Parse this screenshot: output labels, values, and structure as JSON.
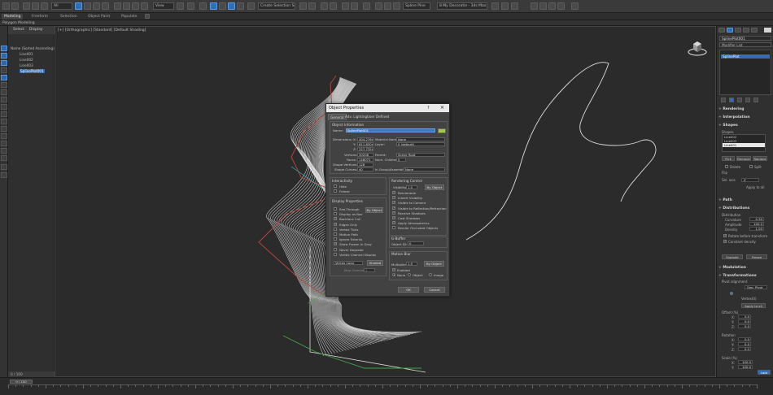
{
  "toolbar": {
    "selection_filter": "All",
    "ref_coord": "View",
    "named_selection": "Create Selection Se...",
    "object_name": "Spline Pine",
    "workspace": "8 My Decoratie - 3ds Max 2017"
  },
  "ribbon": {
    "tabs": [
      "Modeling",
      "Freeform",
      "Selection",
      "Object Paint",
      "Populate"
    ],
    "sub": "Polygon Modeling"
  },
  "explorer": {
    "tabs": [
      "Select",
      "Display"
    ],
    "items": [
      "Name (Sorted Ascending)",
      "Line001",
      "Line002",
      "Line003",
      "SplinePlot001"
    ],
    "footer": "0 / 100"
  },
  "viewport": {
    "label": "[+] [Orthographic] [Standard] [Default Shading]"
  },
  "dialog": {
    "title": "Object Properties",
    "help": "?",
    "close": "✕",
    "tabs": [
      "General",
      "Adv. Lighting",
      "User Defined"
    ],
    "object_info": {
      "title": "Object Information",
      "name_label": "Name:",
      "name_value": "SplinePlot001",
      "dimensions_label": "Dimensions:",
      "dim_x_label": "X:",
      "dim_x": "404.276m",
      "dim_y_label": "Y:",
      "dim_y": "611.830m",
      "dim_z_label": "Z:",
      "dim_z": "227.735m",
      "material_name_label": "Material Name:",
      "material_name": "None",
      "layer_label": "Layer:",
      "layer": "0 (default)",
      "vertices_label": "Vertices:",
      "vertices": "30208",
      "faces_label": "Faces:",
      "faces": "148072",
      "shape_vertices_label": "Shape Vertices:",
      "shape_vertices": "128",
      "shape_curves_label": "Shape Curves:",
      "shape_curves": "40",
      "parent_label": "Parent:",
      "parent": "Scene Root",
      "num_children_label": "Num. Children:",
      "num_children": "0",
      "in_group_label": "In Group/Assembly:",
      "in_group": "None"
    },
    "interactivity": {
      "title": "Interactivity",
      "hide": "Hide",
      "freeze": "Freeze"
    },
    "display_props": {
      "title": "Display Properties",
      "items": [
        "See-Through",
        "Display as Box",
        "Backface Cull",
        "Edges Only",
        "Vertex Ticks",
        "Motion Path",
        "Ignore Extents",
        "Show Frozen in Gray",
        "Never Degrade",
        "Vertex Channel Display"
      ],
      "checked": [
        false,
        false,
        true,
        true,
        false,
        false,
        false,
        true,
        false,
        false
      ],
      "by_object": "By Object",
      "vertex_color": "Vertex Color",
      "shaded": "Shaded",
      "map_channel_label": "Map Channel:",
      "map_channel": "1"
    },
    "rendering": {
      "title": "Rendering Control",
      "visibility_label": "Visibility:",
      "visibility": "1.0",
      "by_object": "By Object",
      "items": [
        "Renderable",
        "Inherit Visibility",
        "Visible to Camera",
        "Visible to Reflection/Refraction",
        "Receive Shadows",
        "Cast Shadows",
        "Apply Atmospherics",
        "Render Occluded Objects"
      ],
      "checked": [
        true,
        true,
        true,
        true,
        true,
        true,
        true,
        false
      ]
    },
    "gbuffer": {
      "title": "G-Buffer",
      "object_id_label": "Object ID:",
      "object_id": "0"
    },
    "motion_blur": {
      "title": "Motion Blur",
      "multiplier_label": "Multiplier:",
      "multiplier": "1.0",
      "by_object": "By Object",
      "enabled": "Enabled",
      "none": "None",
      "object": "Object",
      "image": "Image"
    },
    "ok": "OK",
    "cancel": "Cancel"
  },
  "command_panel": {
    "object_name": "SplinePlot001",
    "modifier_list": "Modifier List",
    "stack_item": "SplinePlot",
    "rollouts": [
      "Rendering",
      "Interpolation",
      "Shapes",
      "Path",
      "Distributions",
      "Modulation",
      "Transformations"
    ],
    "shapes_label": "Shapes",
    "shape_items": [
      "Line002",
      "Line003",
      "Line001"
    ],
    "pick": "Pick",
    "remove": "Remove",
    "replace": "Replace",
    "delete": "Delete",
    "flip": "Flip",
    "split": "Split",
    "sel_axis_label": "Sel. axis",
    "sel_axis": "Z",
    "apply_to_all": "Apply to all",
    "distribution_label": "Distribution",
    "curvature_label": "Curvature",
    "curvature": "0.30",
    "amplitude_label": "Amplitude",
    "amplitude": "100.0",
    "density_label": "Density",
    "density": "1.00",
    "rotate_before": "Rotate before transform",
    "constant_density": "Constant density",
    "explode": "Explode",
    "freeze": "Freeze",
    "pivot_alignment": "Pivot alignment",
    "align_label": "Geo. Pivot",
    "vertex_label": "Vertex(0)",
    "apply_all_btn": "Apply to all",
    "offset_label": "Offset (%)",
    "rotation_label": "Rotation",
    "scale_label": "Scale (%)",
    "x_label": "X:",
    "y_label": "Y:",
    "z_label": "Z:",
    "offset_x": "0.0",
    "offset_y": "0.0",
    "offset_z": "0.0",
    "rot_x": "0.0",
    "rot_y": "0.0",
    "rot_z": "0.0",
    "scale_x": "100.0",
    "scale_y": "100.0",
    "lock": "Lock"
  },
  "timeline": {
    "slider": "0 / 100"
  },
  "colors": {
    "accent": "#2f6fb8",
    "object_swatch": "#a3c84a",
    "curve_white": "#e8e8e8",
    "curve_red": "#b84a3a",
    "curve_green": "#3fa645"
  }
}
